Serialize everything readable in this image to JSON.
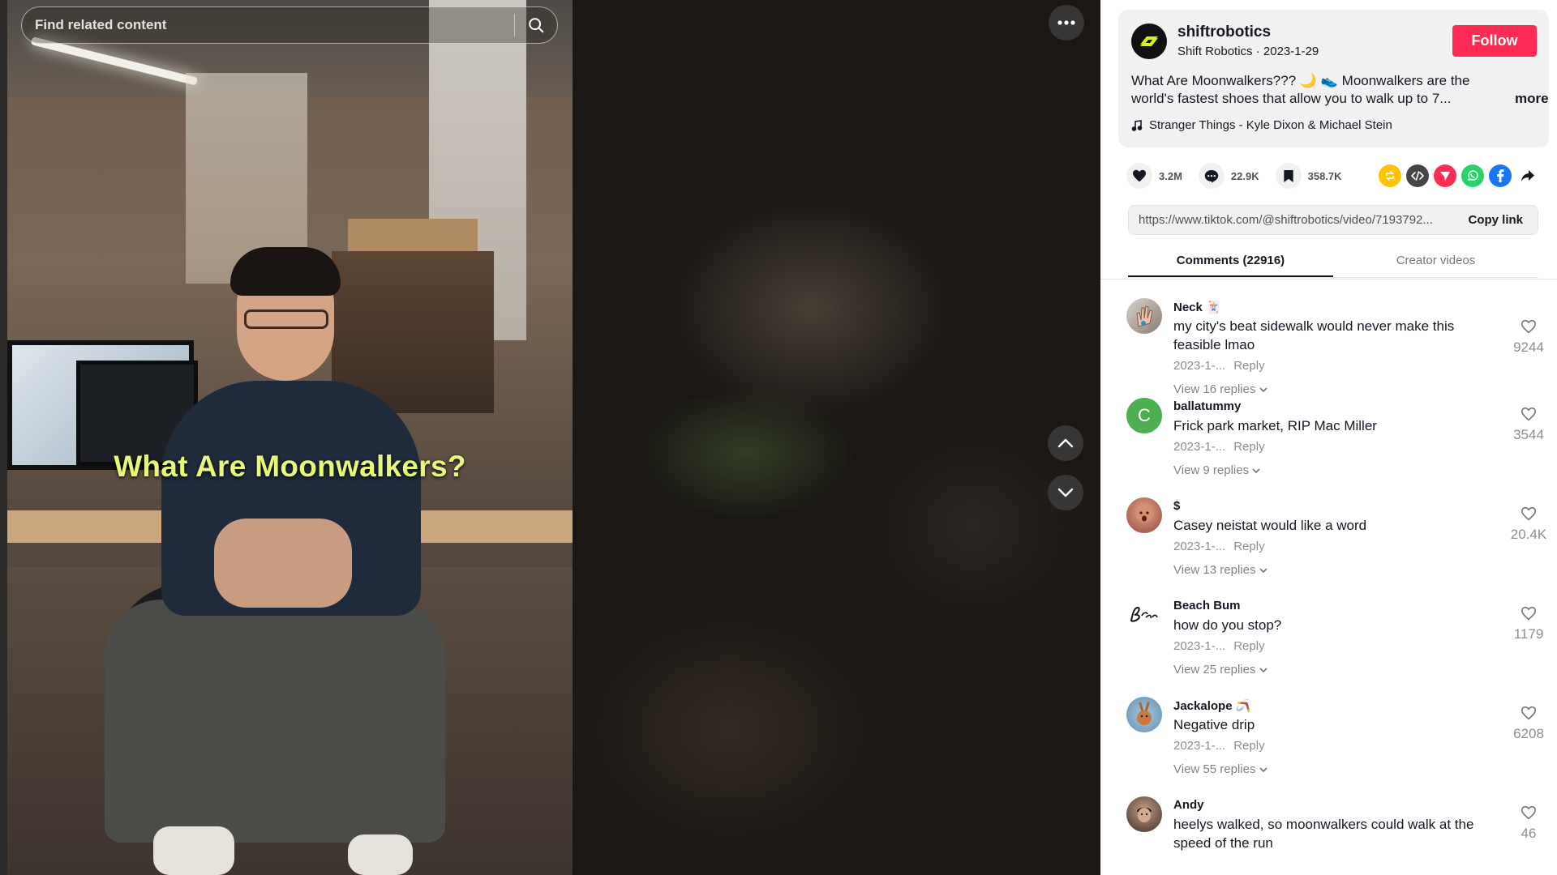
{
  "search": {
    "placeholder": "Find related content"
  },
  "video": {
    "caption": "What Are Moonwalkers?"
  },
  "author": {
    "username": "shiftrobotics",
    "display_name": "Shift Robotics",
    "date": "2023-1-29",
    "follow_label": "Follow",
    "description": "What Are Moonwalkers??? 🌙 👟 Moonwalkers are the world's fastest shoes that allow you to walk up to 7...",
    "more_label": "more",
    "music": "Stranger Things - Kyle Dixon & Michael Stein"
  },
  "stats": {
    "likes": "3.2M",
    "comments": "22.9K",
    "saves": "358.7K"
  },
  "share_icons": [
    "repost-icon",
    "embed-icon",
    "send-icon",
    "whatsapp-icon",
    "facebook-icon",
    "share-arrow-icon"
  ],
  "link": {
    "url": "https://www.tiktok.com/@shiftrobotics/video/7193792...",
    "copy_label": "Copy link"
  },
  "tabs": [
    {
      "label": "Comments (22916)",
      "active": true
    },
    {
      "label": "Creator videos",
      "active": false
    }
  ],
  "comments": [
    {
      "user": "Neck 🃏",
      "text": "my city's beat sidewalk would never make this feasible lmao",
      "date": "2023-1-...",
      "reply": "Reply",
      "view_replies": "View 16 replies",
      "likes": "9244"
    },
    {
      "user": "ballatummy",
      "text": "Frick park market, RIP Mac Miller",
      "date": "2023-1-...",
      "reply": "Reply",
      "view_replies": "View 9 replies",
      "likes": "3544",
      "avatar_letter": "C"
    },
    {
      "user": "$",
      "text": "Casey neistat would like a word",
      "date": "2023-1-...",
      "reply": "Reply",
      "view_replies": "View 13 replies",
      "likes": "20.4K"
    },
    {
      "user": "Beach Bum",
      "text": "how do you stop?",
      "date": "2023-1-...",
      "reply": "Reply",
      "view_replies": "View 25 replies",
      "likes": "1179"
    },
    {
      "user": "Jackalope 🪃",
      "text": "Negative drip",
      "date": "2023-1-...",
      "reply": "Reply",
      "view_replies": "View 55 replies",
      "likes": "6208"
    },
    {
      "user": "Andy",
      "text": "heelys walked, so moonwalkers could walk at the speed of the run",
      "likes": "46"
    }
  ],
  "colors": {
    "follow": "#fe2c55",
    "caption": "#e7f77a",
    "text": "#161823"
  }
}
